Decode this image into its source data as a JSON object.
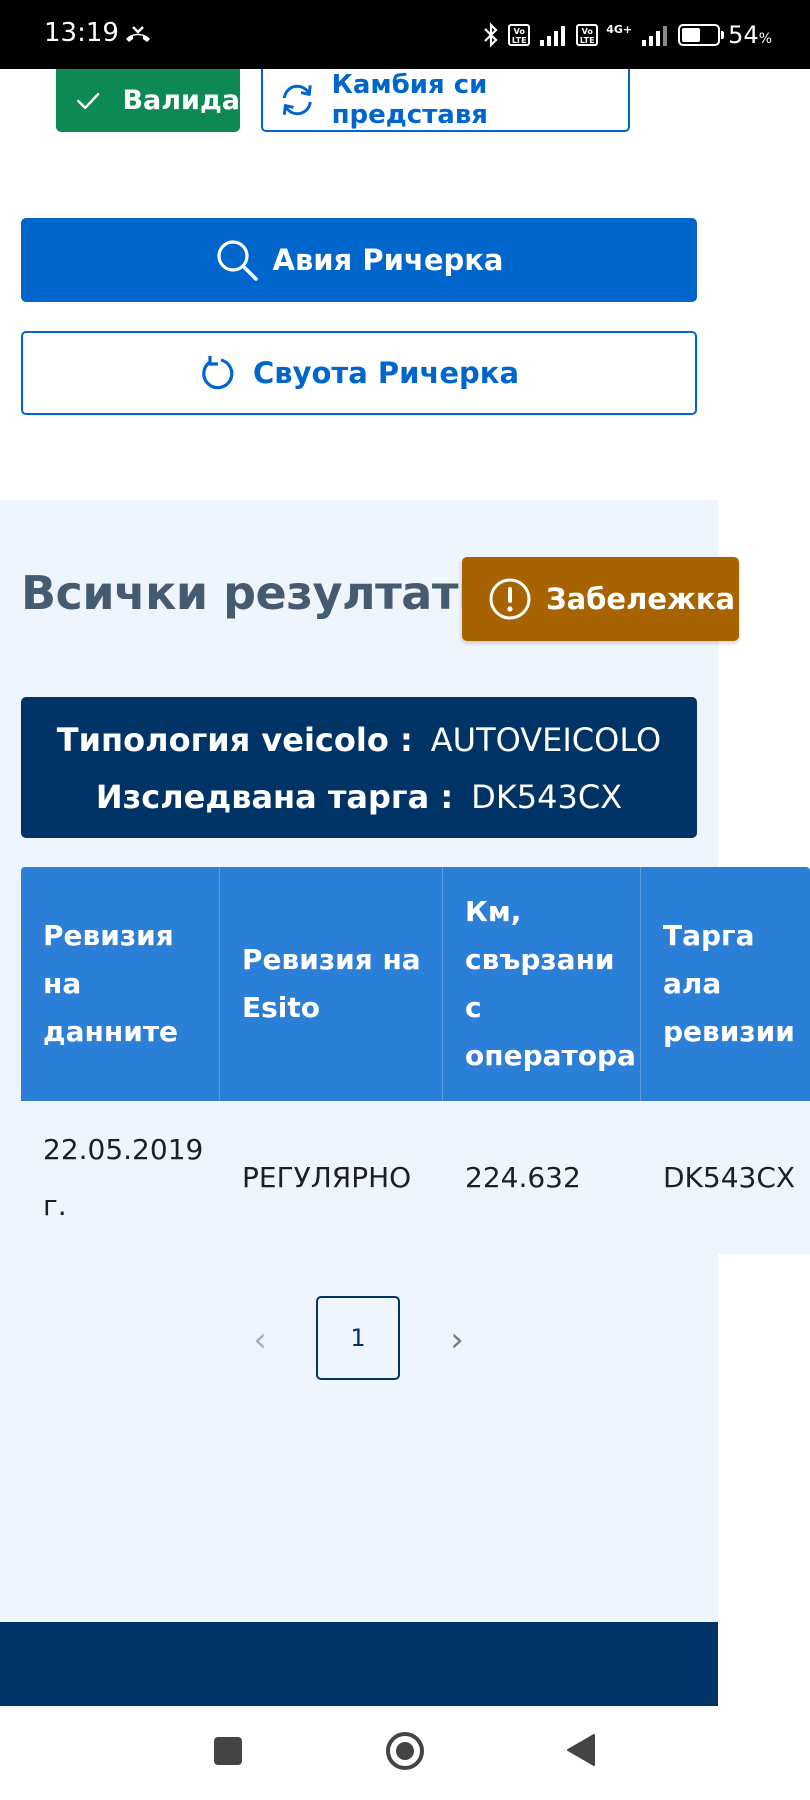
{
  "status_bar": {
    "time": "13:19",
    "volte_1": "Vo LTE",
    "volte_2": "Vo LTE",
    "network": "4G+",
    "battery_percent": "54",
    "battery_unit": "%",
    "battery_level": 0.54
  },
  "toolbar": {
    "valid_label": "Валида",
    "change_label": "Камбия си представя"
  },
  "search": {
    "start_label": "Авия Ричерка",
    "reset_label": "Свуота Ричерка"
  },
  "results": {
    "title": "Всички резултати",
    "note_label": "Забележка",
    "vehicle_type_label": "Типология veicolo :",
    "vehicle_type_value": "AUTOVEICOLO",
    "plate_label": "Изследвана тарга :",
    "plate_value": "DK543CX"
  },
  "table": {
    "headers": [
      "Ревизия на данните",
      "Ревизия на Esito",
      "Км, свързани с оператора",
      "Тарга ала ревизии"
    ],
    "rows": [
      [
        "22.05.2019 г.",
        "РЕГУЛЯРНО",
        "224.632",
        "DK543CX"
      ]
    ]
  },
  "pagination": {
    "prev": "‹",
    "current": "1",
    "next": "›"
  },
  "colors": {
    "primary": "#0066cc",
    "success": "#0d8a53",
    "warning": "#a66300",
    "dark_blue": "#003366",
    "table_header": "#2b7fd6",
    "section_bg": "#eff5fc"
  }
}
